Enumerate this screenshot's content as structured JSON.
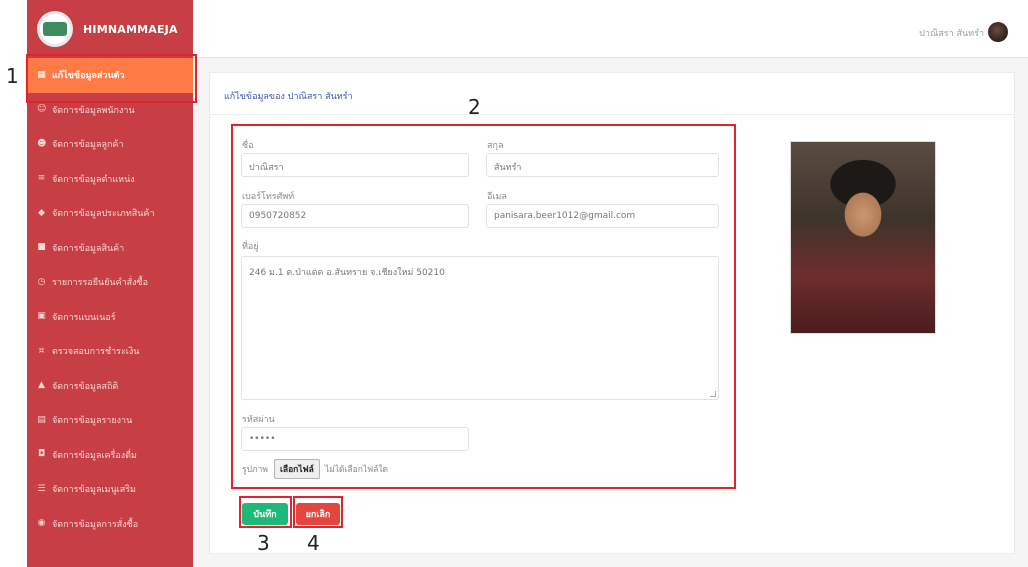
{
  "app": {
    "brand_name": "HIMNAMMAEJA",
    "user_name": "ปาณิสรา สันทรำ"
  },
  "sidebar": {
    "items": [
      {
        "label": "แก้ไขข้อมูลส่วนตัว",
        "icon": "table-icon",
        "active": true
      },
      {
        "label": "จัดการข้อมูลพนักงาน",
        "icon": "users-icon",
        "active": false
      },
      {
        "label": "จัดการข้อมูลลูกค้า",
        "icon": "user-icon",
        "active": false
      },
      {
        "label": "จัดการข้อมูลตำแหน่ง",
        "icon": "list-icon",
        "active": false
      },
      {
        "label": "จัดการข้อมูลประเภทสินค้า",
        "icon": "tag-icon",
        "active": false
      },
      {
        "label": "จัดการข้อมูลสินค้า",
        "icon": "box-icon",
        "active": false
      },
      {
        "label": "รายการรอยืนยันคำสั่งซื้อ",
        "icon": "clock-icon",
        "active": false
      },
      {
        "label": "จัดการแบนเนอร์",
        "icon": "image-icon",
        "active": false
      },
      {
        "label": "ตรวจสอบการชำระเงิน",
        "icon": "money-icon",
        "active": false
      },
      {
        "label": "จัดการข้อมูลสถิติ",
        "icon": "chart-icon",
        "active": false
      },
      {
        "label": "จัดการข้อมูลรายงาน",
        "icon": "report-icon",
        "active": false
      },
      {
        "label": "จัดการข้อมูลเครื่องดื่ม",
        "icon": "cup-icon",
        "active": false
      },
      {
        "label": "จัดการข้อมูลเมนูเสริม",
        "icon": "menu-icon",
        "active": false
      },
      {
        "label": "จัดการข้อมูลการสั่งซื้อ",
        "icon": "cart-icon",
        "active": false
      }
    ]
  },
  "page": {
    "header": "แก้ไขข้อมูลของ ปาณิสรา สันทรำ"
  },
  "form": {
    "first_name_label": "ชื่อ",
    "first_name_value": "ปาณิสรา",
    "last_name_label": "สกุล",
    "last_name_value": "สันทรำ",
    "phone_label": "เบอร์โทรศัพท์",
    "phone_value": "0950720852",
    "email_label": "อีเมล",
    "email_value": "panisara.beer1012@gmail.com",
    "address_label": "ที่อยู่",
    "address_value": "246 ม.1 ต.ป่าแดด อ.สันทราย จ.เชียงใหม่ 50210",
    "password_label": "รหัสผ่าน",
    "password_value": "•••••",
    "image_label": "รูปภาพ",
    "file_button_label": "เลือกไฟล์",
    "file_none_label": "ไม่ได้เลือกไฟล์ใด"
  },
  "actions": {
    "save_label": "บันทึก",
    "cancel_label": "ยกเลิก"
  },
  "annotations": {
    "one": "1",
    "two": "2",
    "three": "3",
    "four": "4"
  },
  "colors": {
    "sidebar": "#c73f44",
    "active_item": "#ff7a45",
    "save": "#1db97a",
    "cancel": "#e2463f",
    "annotation": "#e0242a"
  }
}
